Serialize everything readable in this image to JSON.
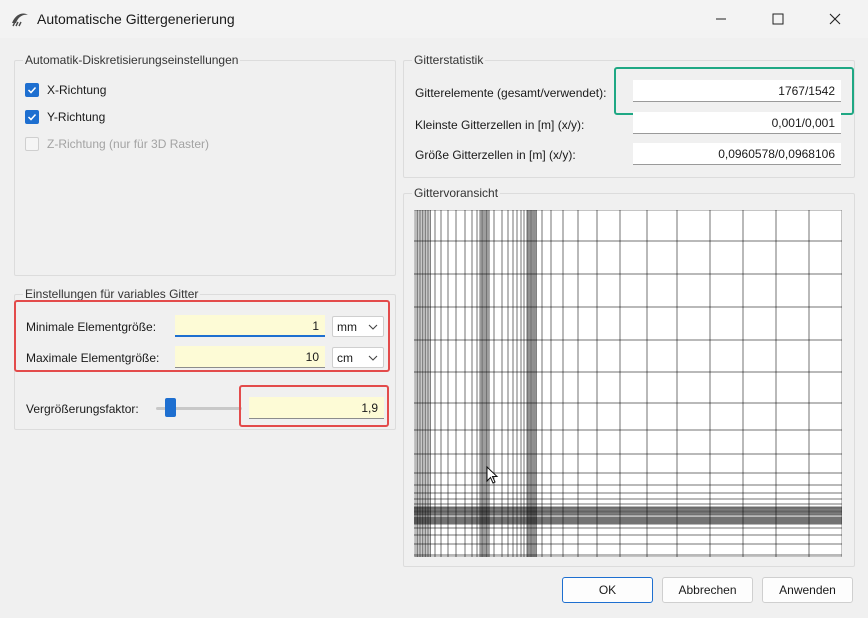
{
  "window": {
    "title": "Automatische Gittergenerierung"
  },
  "discretization": {
    "title": "Automatik-Diskretisierungseinstellungen",
    "options": [
      {
        "label": "X-Richtung",
        "checked": true,
        "enabled": true
      },
      {
        "label": "Y-Richtung",
        "checked": true,
        "enabled": true
      },
      {
        "label": "Z-Richtung (nur für 3D Raster)",
        "checked": false,
        "enabled": false
      }
    ]
  },
  "variable_grid": {
    "title": "Einstellungen für variables Gitter",
    "min_label": "Minimale Elementgröße:",
    "min_value": "1",
    "min_unit": "mm",
    "max_label": "Maximale Elementgröße:",
    "max_value": "10",
    "max_unit": "cm",
    "factor_label": "Vergrößerungsfaktor:",
    "factor_value": "1,9",
    "factor_slider_fraction": 0.16
  },
  "statistics": {
    "title": "Gitterstatistik",
    "elements_label": "Gitterelemente (gesamt/verwendet):",
    "elements_value": "1767/1542",
    "smallest_label": "Kleinste Gitterzellen in [m] (x/y):",
    "smallest_value": "0,001/0,001",
    "largest_label": "Größe Gitterzellen in [m] (x/y):",
    "largest_value": "0,0960578/0,0968106"
  },
  "preview": {
    "title": "Gittervoransicht"
  },
  "buttons": {
    "ok": "OK",
    "cancel": "Abbrechen",
    "apply": "Anwenden"
  },
  "colors": {
    "accent": "#1e6fd0",
    "highlight_red": "#e34b4b",
    "highlight_green": "#1fa884",
    "input_yellow": "#fdfbd6"
  }
}
